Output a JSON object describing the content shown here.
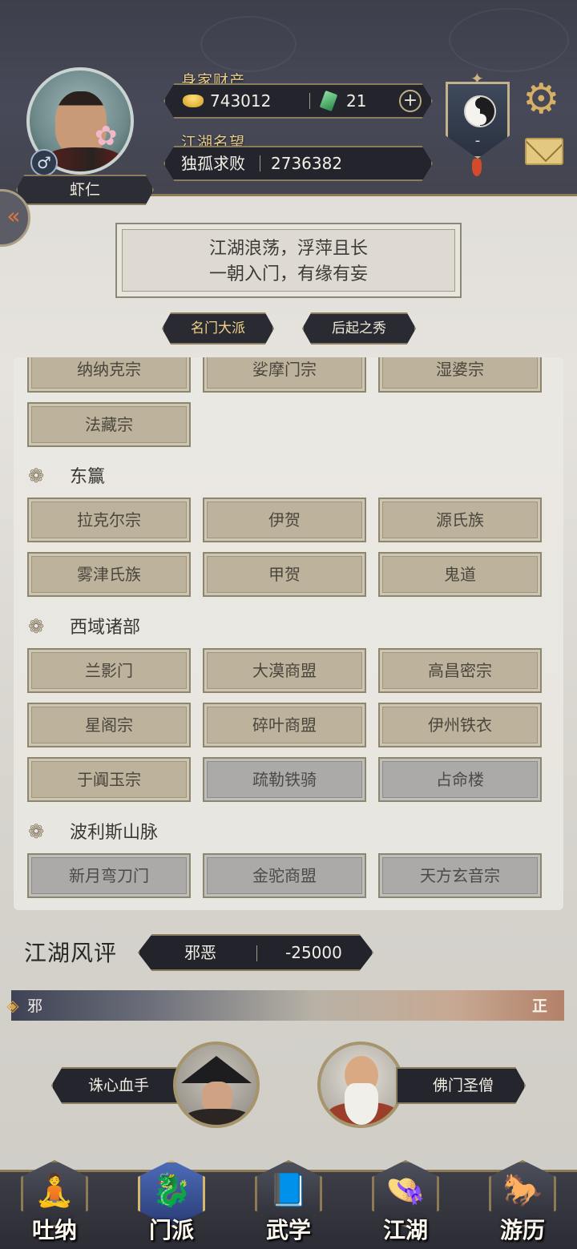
{
  "header": {
    "player_name": "虾仁",
    "gender_symbol": "♂",
    "wealth_title": "身家财产",
    "gold": "743012",
    "jade": "21",
    "add_symbol": "+",
    "fame_title": "江湖名望",
    "fame_rank": "独孤求败",
    "fame_value": "2736382",
    "faction_value": "-",
    "side_tab_symbol": "«"
  },
  "motto": {
    "line1": "江湖浪荡，浮萍且长",
    "line2": "一朝入门，有缘有妄"
  },
  "tabs": [
    {
      "label": "名门大派",
      "active": true
    },
    {
      "label": "后起之秀",
      "active": false
    }
  ],
  "sects": {
    "top_partial": [
      "纳纳克宗",
      "娑摩门宗",
      "湿婆宗"
    ],
    "misc": [
      "法藏宗"
    ],
    "regions": [
      {
        "name": "东籯",
        "items": [
          "拉克尔宗",
          "伊贺",
          "源氏族",
          "雾津氏族",
          "甲贺",
          "鬼道"
        ]
      },
      {
        "name": "西域诸部",
        "items": [
          "兰影门",
          "大漠商盟",
          "高昌密宗",
          "星阁宗",
          "碎叶商盟",
          "伊州铁衣",
          "于阗玉宗",
          "疏勒铁骑",
          "占命楼"
        ]
      },
      {
        "name": "波利斯山脉",
        "items": [
          "新月弯刀门",
          "金驼商盟",
          "天方玄音宗"
        ]
      }
    ]
  },
  "reputation": {
    "title": "江湖风评",
    "label": "邪恶",
    "value": "-25000",
    "left_end": "邪",
    "right_end": "正",
    "marker_fraction": 0.0
  },
  "masters": [
    {
      "name": "诛心血手"
    },
    {
      "name": "佛门圣僧"
    }
  ],
  "nav": [
    {
      "label": "吐纳",
      "icon": "meditate-icon",
      "glyph": "🧘"
    },
    {
      "label": "门派",
      "icon": "sect-banner-icon",
      "glyph": "🐉"
    },
    {
      "label": "武学",
      "icon": "martial-book-icon",
      "glyph": "📘"
    },
    {
      "label": "江湖",
      "icon": "bamboo-hat-icon",
      "glyph": "👒"
    },
    {
      "label": "游历",
      "icon": "horse-icon",
      "glyph": "🐎"
    }
  ],
  "colors": {
    "header_bg": "#43444f",
    "gold_accent": "#e9ce8f",
    "sect_active": "#bdb39d",
    "sect_inactive": "#abaaa8"
  }
}
